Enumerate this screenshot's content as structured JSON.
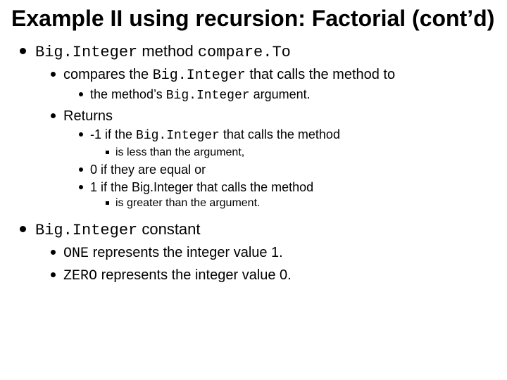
{
  "title": "Example II using recursion: Factorial (cont’d)",
  "b1": {
    "pre": "Big.Integer",
    "mid": " method ",
    "post": "compare.To",
    "sub1": {
      "pre": "compares the ",
      "code": "Big.Integer",
      "post": " that calls the method to",
      "sub": {
        "pre": "the method’s ",
        "code": "Big.Integer",
        "post": " argument."
      }
    },
    "sub2": {
      "label": "Returns",
      "r1": {
        "pre": "-1 if the ",
        "code": "Big.Integer",
        "post": " that calls the method",
        "tail": "is less than the argument,"
      },
      "r2": "0 if they are equal or",
      "r3": {
        "text": "1 if the Big.Integer that calls the method",
        "tail": "is greater than the argument."
      }
    }
  },
  "b2": {
    "pre": "Big.Integer",
    "post": " constant",
    "one": {
      "code": "ONE",
      "post": " represents the integer value 1."
    },
    "zero": {
      "code": "ZERO",
      "post": " represents the integer value 0."
    }
  }
}
